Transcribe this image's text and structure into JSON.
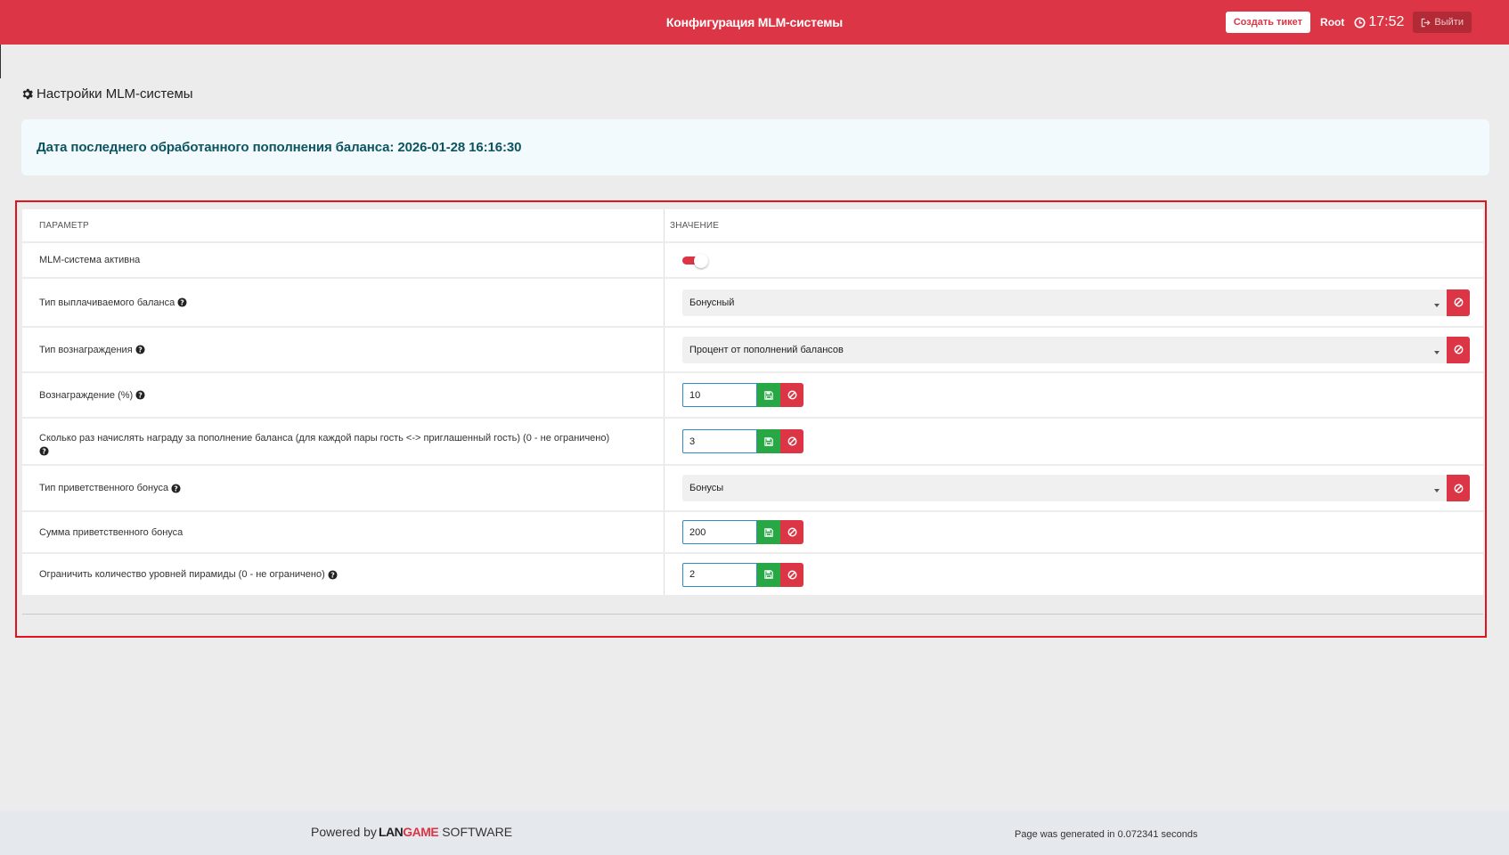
{
  "header": {
    "title": "Конфигурация MLM-системы",
    "ticket_button": "Создать тикет",
    "user": "Root",
    "time": "17:52",
    "logout_button": "Выйти",
    "brand_color": "#dc3545"
  },
  "page": {
    "title": "Настройки MLM-системы",
    "info": "Дата последнего обработанного пополнения баланса: 2026-01-28 16:16:30"
  },
  "table": {
    "col_param": "ПАРАМЕТР",
    "col_value": "ЗНАЧЕНИЕ",
    "rows": [
      {
        "label": "MLM-система активна",
        "type": "toggle",
        "on": true
      },
      {
        "label": "Тип выплачиваемого баланса",
        "type": "select",
        "value": "Бонусный",
        "help": true
      },
      {
        "label": "Тип вознаграждения",
        "type": "select",
        "value": "Процент от пополнений балансов",
        "help": true
      },
      {
        "label": "Вознаграждение (%)",
        "type": "number",
        "value": "10",
        "help": true
      },
      {
        "label": "Сколько раз начислять награду за пополнение баланса (для каждой пары гость <-> приглашенный гость) (0 - не ограничено)",
        "type": "number",
        "value": "3",
        "help": true
      },
      {
        "label": "Тип приветственного бонуса",
        "type": "select",
        "value": "Бонусы",
        "help": true
      },
      {
        "label": "Сумма приветственного бонуса",
        "type": "number",
        "value": "200",
        "help": false
      },
      {
        "label": "Ограничить количество уровней пирамиды (0 - не ограничено)",
        "type": "number",
        "value": "2",
        "help": true
      }
    ]
  },
  "footer": {
    "powered_by": "Powered by",
    "brand_lan": "LAN",
    "brand_game": "GAME",
    "brand_software": "SOFTWARE",
    "generated": "Page was generated in 0.072341 seconds"
  }
}
